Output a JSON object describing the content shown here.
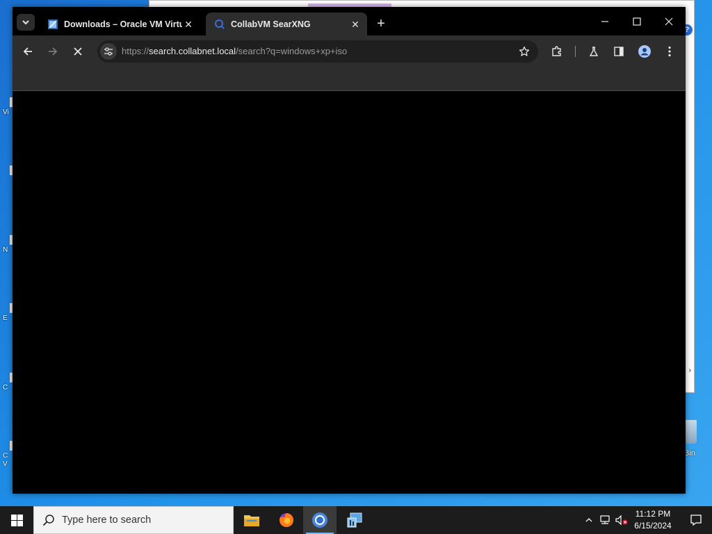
{
  "desktop": {
    "icons": [
      {
        "label": "Vi"
      },
      {
        "label": ""
      },
      {
        "label": "N"
      },
      {
        "label": "E"
      },
      {
        "label": "C"
      },
      {
        "label": "C\nV"
      }
    ],
    "recycle_bin_label": "Bin"
  },
  "browser": {
    "tabs": [
      {
        "title": "Downloads – Oracle VM Virtua",
        "active": false
      },
      {
        "title": "CollabVM SearXNG",
        "active": true
      }
    ],
    "new_tab_label": "+",
    "address": {
      "scheme": "https://",
      "host": "search.collabnet.local",
      "path": "/search?q=windows+xp+iso"
    },
    "loading": true
  },
  "taskbar": {
    "search_placeholder": "Type here to search",
    "apps": [
      "file-explorer",
      "firefox",
      "chrome",
      "control-panel"
    ],
    "active_app": "chrome",
    "clock": {
      "time": "11:12 PM",
      "date": "6/15/2024"
    }
  },
  "colors": {
    "desktop_bg": "#1f8fe8",
    "taskbar_bg": "#1c1c1c",
    "browser_toolbar": "#2d2d2d",
    "accent": "#76b9ed"
  }
}
